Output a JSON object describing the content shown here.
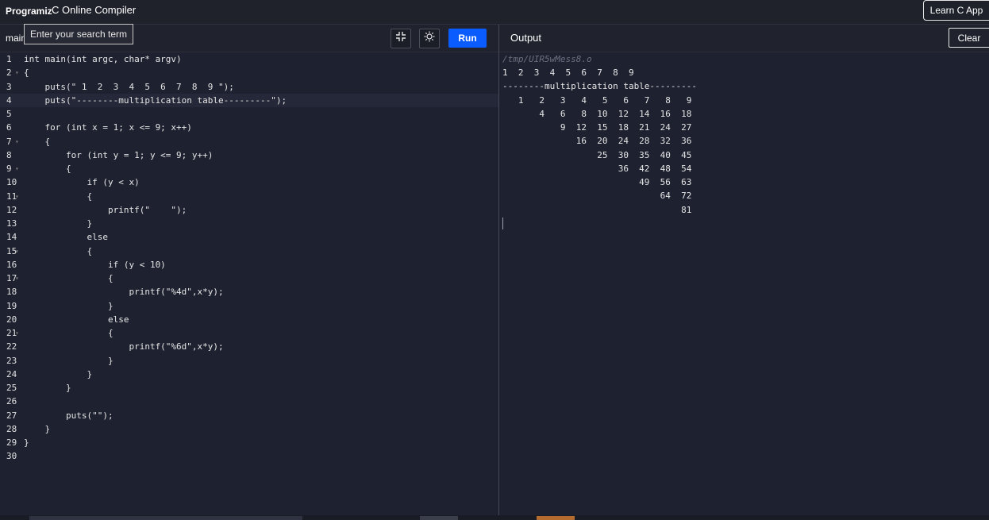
{
  "header": {
    "logo": "Programiz",
    "title": "C Online Compiler",
    "learn_button": "Learn C App"
  },
  "editor": {
    "tab_name": "main",
    "search_placeholder": "Enter your search term",
    "run_label": "Run",
    "lines": [
      {
        "num": "1",
        "text": "int main(int argc, char* argv)"
      },
      {
        "num": "2",
        "text": "{"
      },
      {
        "num": "3",
        "text": "    puts(\" 1  2  3  4  5  6  7  8  9 \");"
      },
      {
        "num": "4",
        "text": "    puts(\"--------multiplication table---------\");"
      },
      {
        "num": "5",
        "text": ""
      },
      {
        "num": "6",
        "text": "    for (int x = 1; x <= 9; x++)"
      },
      {
        "num": "7",
        "text": "    {"
      },
      {
        "num": "8",
        "text": "        for (int y = 1; y <= 9; y++)"
      },
      {
        "num": "9",
        "text": "        {"
      },
      {
        "num": "10",
        "text": "            if (y < x)"
      },
      {
        "num": "11",
        "text": "            {"
      },
      {
        "num": "12",
        "text": "                printf(\"    \");"
      },
      {
        "num": "13",
        "text": "            }"
      },
      {
        "num": "14",
        "text": "            else"
      },
      {
        "num": "15",
        "text": "            {"
      },
      {
        "num": "16",
        "text": "                if (y < 10)"
      },
      {
        "num": "17",
        "text": "                {"
      },
      {
        "num": "18",
        "text": "                    printf(\"%4d\",x*y);"
      },
      {
        "num": "19",
        "text": "                }"
      },
      {
        "num": "20",
        "text": "                else"
      },
      {
        "num": "21",
        "text": "                {"
      },
      {
        "num": "22",
        "text": "                    printf(\"%6d\",x*y);"
      },
      {
        "num": "23",
        "text": "                }"
      },
      {
        "num": "24",
        "text": "            }"
      },
      {
        "num": "25",
        "text": "        }"
      },
      {
        "num": "26",
        "text": ""
      },
      {
        "num": "27",
        "text": "        puts(\"\");"
      },
      {
        "num": "28",
        "text": "    }"
      },
      {
        "num": "29",
        "text": "}"
      },
      {
        "num": "30",
        "text": ""
      }
    ]
  },
  "output": {
    "title": "Output",
    "clear_label": "Clear",
    "path": "/tmp/UIR5wMess8.o",
    "lines": [
      "1  2  3  4  5  6  7  8  9",
      "--------multiplication table---------",
      "   1   2   3   4   5   6   7   8   9",
      "       4   6   8  10  12  14  16  18",
      "           9  12  15  18  21  24  27",
      "              16  20  24  28  32  36",
      "                  25  30  35  40  45",
      "                      36  42  48  54",
      "                          49  56  63",
      "                              64  72",
      "                                  81"
    ]
  }
}
